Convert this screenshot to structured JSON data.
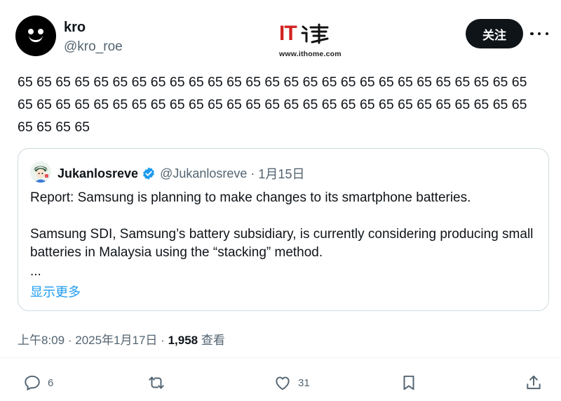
{
  "author": {
    "display_name": "kro",
    "handle": "@kro_roe"
  },
  "watermark": {
    "logo_text": "IT",
    "url": "www.ithome.com"
  },
  "follow_button": {
    "label": "关注"
  },
  "more_menu": {
    "icon": "more-horizontal-icon"
  },
  "tweet": {
    "text": "65 65 65 65 65 65 65 65 65 65 65 65 65 65 65 65 65 65 65 65 65 65 65 65 65 65 65 65 65 65 65 65 65 65 65 65 65 65 65 65 65 65 65 65 65 65 65 65 65 65 65 65 65 65 65 65 65 65"
  },
  "quoted_tweet": {
    "display_name": "Jukanlosreve",
    "verified": true,
    "handle": "@Jukanlosreve",
    "separator": "·",
    "date": "1月15日",
    "paragraph_1": "Report: Samsung is planning to make changes to its smartphone batteries.",
    "paragraph_2": "Samsung SDI, Samsung’s battery subsidiary, is currently considering producing small batteries in Malaysia using the “stacking” method.",
    "ellipsis": "...",
    "show_more": "显示更多"
  },
  "meta": {
    "time": "上午8:09",
    "separator": "·",
    "date": "2025年1月17日",
    "views_count": "1,958",
    "views_label": "查看"
  },
  "actions": {
    "reply_count": "6",
    "retweet_count": "",
    "like_count": "31"
  },
  "colors": {
    "text": "#0f1419",
    "secondary": "#536471",
    "link": "#1d9bf0",
    "verified": "#1d9bf0",
    "border": "#cfd9de",
    "watermark_red": "#d22222"
  }
}
